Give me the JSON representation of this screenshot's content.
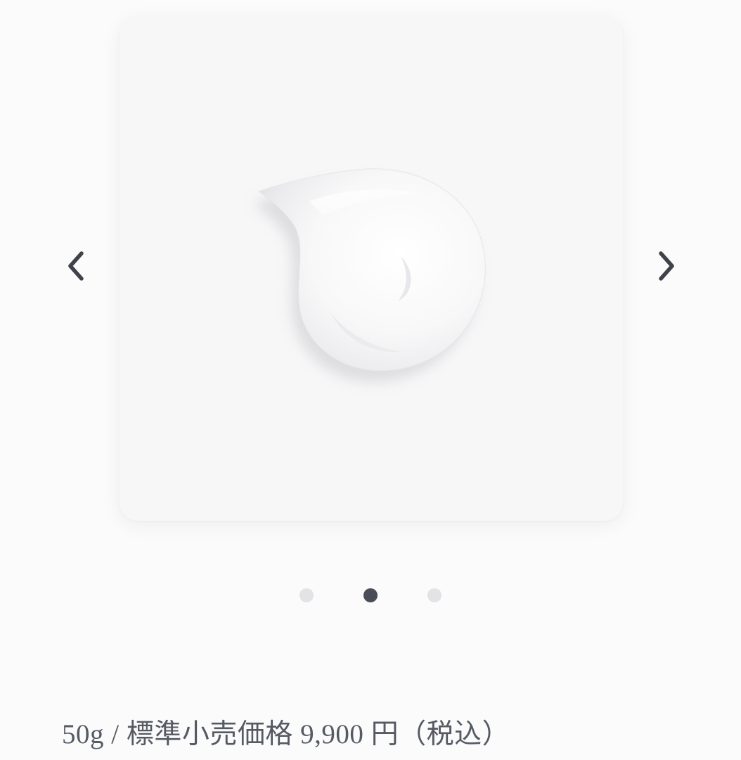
{
  "carousel": {
    "image_alt": "cream texture swatch",
    "prev_icon": "chevron-left-icon",
    "next_icon": "chevron-right-icon",
    "slide_count": 3,
    "active_slide": 2,
    "colors": {
      "card_background": "#f7f7f8",
      "arrow": "#3f4249",
      "dot_active": "#4a4d55",
      "dot_inactive": "#e3e3e5"
    }
  },
  "product": {
    "price_line": "50g / 標準小売価格 9,900 円（税込）"
  }
}
